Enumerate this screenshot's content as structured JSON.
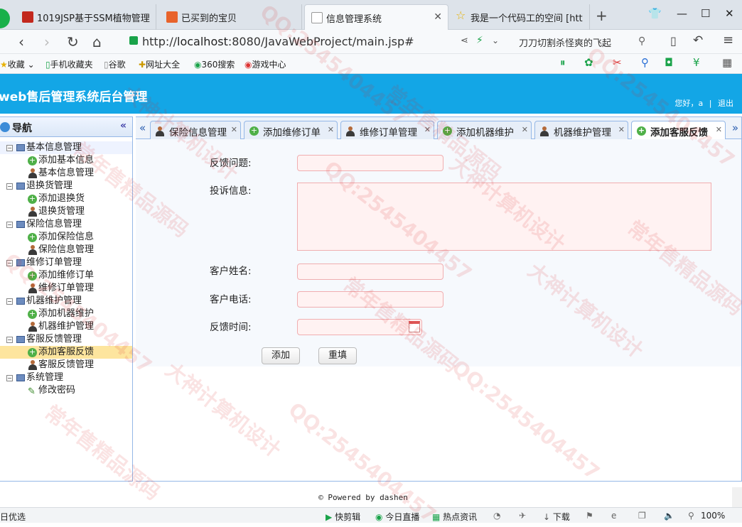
{
  "browser": {
    "tabs": [
      {
        "title": "1019JSP基于SSM植物管理"
      },
      {
        "title": "已买到的宝贝"
      },
      {
        "title": "信息管理系统"
      },
      {
        "title": "我是一个代码工的空间 [htt"
      }
    ],
    "url_prefix": "http://",
    "url_host": "localhost",
    "url_rest": ":8080/JavaWebProject/main.jsp#",
    "search_text": "刀刀切割杀怪爽的飞起",
    "bookmarks": [
      "收藏",
      "手机收藏夹",
      "谷歌",
      "网址大全",
      "360搜索",
      "游戏中心"
    ]
  },
  "app": {
    "title": "web售后管理系统后台管理",
    "greeting": "您好，a",
    "separator": "|",
    "logout": "退出"
  },
  "nav": {
    "title": "导航",
    "collapse": "«",
    "groups": [
      {
        "label": "基本信息管理",
        "children": [
          {
            "label": "添加基本信息",
            "icon": "add"
          },
          {
            "label": "基本信息管理",
            "icon": "user"
          }
        ]
      },
      {
        "label": "退换货管理",
        "children": [
          {
            "label": "添加退换货",
            "icon": "add"
          },
          {
            "label": "退换货管理",
            "icon": "user"
          }
        ]
      },
      {
        "label": "保险信息管理",
        "children": [
          {
            "label": "添加保险信息",
            "icon": "add"
          },
          {
            "label": "保险信息管理",
            "icon": "user"
          }
        ]
      },
      {
        "label": "维修订单管理",
        "children": [
          {
            "label": "添加维修订单",
            "icon": "add"
          },
          {
            "label": "维修订单管理",
            "icon": "user"
          }
        ]
      },
      {
        "label": "机器维护管理",
        "children": [
          {
            "label": "添加机器维护",
            "icon": "add"
          },
          {
            "label": "机器维护管理",
            "icon": "user"
          }
        ]
      },
      {
        "label": "客服反馈管理",
        "children": [
          {
            "label": "添加客服反馈",
            "icon": "add"
          },
          {
            "label": "客服反馈管理",
            "icon": "user"
          }
        ]
      },
      {
        "label": "系统管理",
        "children": [
          {
            "label": "修改密码",
            "icon": "pen"
          }
        ]
      }
    ]
  },
  "tabs": [
    {
      "label": "保险信息管理",
      "icon": "user"
    },
    {
      "label": "添加维修订单",
      "icon": "add"
    },
    {
      "label": "维修订单管理",
      "icon": "user"
    },
    {
      "label": "添加机器维护",
      "icon": "add"
    },
    {
      "label": "机器维护管理",
      "icon": "user"
    },
    {
      "label": "添加客服反馈",
      "icon": "add"
    }
  ],
  "form": {
    "feedback_problem_label": "反馈问题:",
    "complaint_label": "投诉信息:",
    "customer_name_label": "客户姓名:",
    "customer_phone_label": "客户电话:",
    "feedback_time_label": "反馈时间:",
    "submit": "添加",
    "reset": "重填"
  },
  "footer": {
    "powered": "© Powered by dashen"
  },
  "statusbar": {
    "left": "日优选",
    "items": [
      "快剪辑",
      "今日直播",
      "热点资讯",
      "下载"
    ],
    "zoom": "100%"
  },
  "watermarks": [
    "QQ:2545404457",
    "大神计算机设计",
    "常年售精品源码"
  ]
}
